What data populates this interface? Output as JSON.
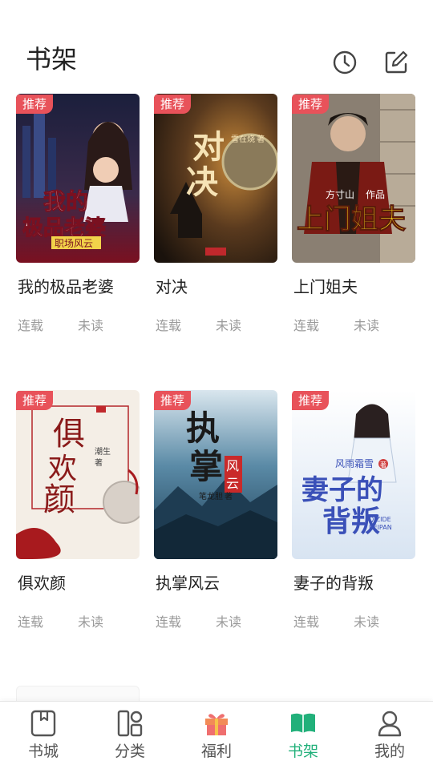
{
  "header": {
    "title": "书架",
    "history_icon": "clock-icon",
    "edit_icon": "edit-icon"
  },
  "books": [
    {
      "badge": "推荐",
      "title": "我的极品老婆",
      "status": "连载",
      "read": "未读",
      "cover_text": [
        "我的",
        "极品老婆",
        "职场风云"
      ],
      "colors": [
        "#1b1f3c",
        "#7a1020"
      ]
    },
    {
      "badge": "推荐",
      "title": "对决",
      "status": "连载",
      "read": "未读",
      "cover_text": [
        "对",
        "决",
        "雪在烧",
        "著"
      ],
      "colors": [
        "#2b2016",
        "#c98a3a"
      ]
    },
    {
      "badge": "推荐",
      "title": "上门姐夫",
      "status": "连载",
      "read": "未读",
      "cover_text": [
        "方寸山",
        "作品",
        "上门姐夫"
      ],
      "colors": [
        "#3a3530",
        "#e3c21a"
      ]
    },
    {
      "badge": "推荐",
      "title": "俱欢颜",
      "status": "连载",
      "read": "未读",
      "cover_text": [
        "俱",
        "欢",
        "颜",
        "潮生",
        "著"
      ],
      "colors": [
        "#f3ece4",
        "#b3262a"
      ]
    },
    {
      "badge": "推荐",
      "title": "执掌风云",
      "status": "连载",
      "read": "未读",
      "cover_text": [
        "执",
        "掌",
        "风",
        "云",
        "笔龙胆",
        "著"
      ],
      "colors": [
        "#1e4a63",
        "#c92a2a"
      ]
    },
    {
      "badge": "推荐",
      "title": "妻子的背叛",
      "status": "连载",
      "read": "未读",
      "cover_text": [
        "风雨霜雪",
        "著",
        "妻子的",
        "背叛",
        "QIZIDE",
        "BEIPAN"
      ],
      "colors": [
        "#e7eef7",
        "#3a50b8"
      ]
    }
  ],
  "tabbar": {
    "items": [
      {
        "label": "书城",
        "icon": "book-city-icon"
      },
      {
        "label": "分类",
        "icon": "category-icon"
      },
      {
        "label": "福利",
        "icon": "gift-icon"
      },
      {
        "label": "书架",
        "icon": "bookshelf-icon",
        "active": true
      },
      {
        "label": "我的",
        "icon": "profile-icon"
      }
    ],
    "active_color": "#21b07a"
  }
}
